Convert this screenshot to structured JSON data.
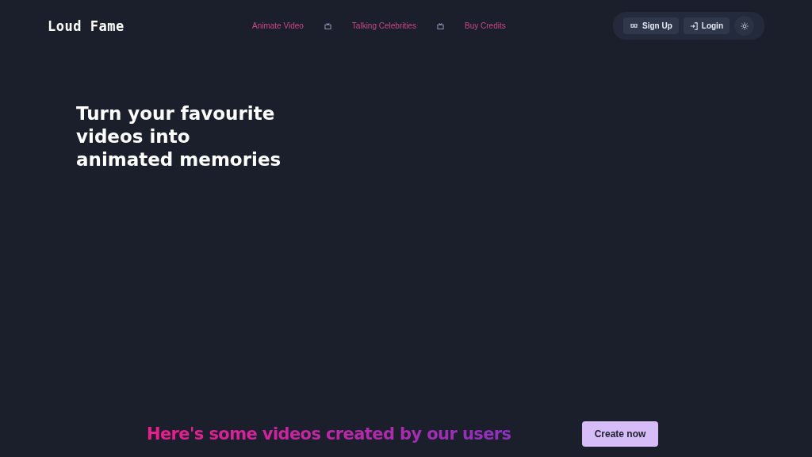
{
  "logo": "Loud Fame",
  "nav": [
    {
      "label": "Animate Video"
    },
    {
      "label": "Talking Celebrities"
    },
    {
      "label": "Buy Credits"
    }
  ],
  "auth": {
    "signup": "Sign Up",
    "login": "Login"
  },
  "hero": {
    "title": "Turn your favourite videos into animated memories"
  },
  "showcase": {
    "heading": "Here's some videos created by our users",
    "button": "Create now"
  }
}
